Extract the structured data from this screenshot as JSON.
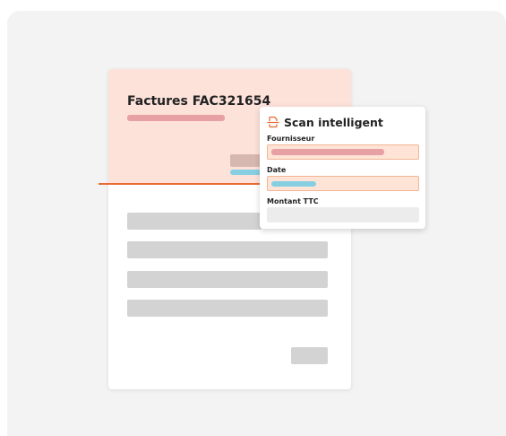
{
  "document": {
    "title": "Factures FAC321654"
  },
  "scan_panel": {
    "title": "Scan intelligent",
    "icon": "scan-document-icon",
    "fields": [
      {
        "label": "Fournisseur",
        "state": "extracted-redacted"
      },
      {
        "label": "Date",
        "state": "extracted-redacted"
      },
      {
        "label": "Montant TTC",
        "state": "empty"
      }
    ]
  },
  "colors": {
    "accent": "#e86b35",
    "highlight_bg": "#fde2da",
    "redacted_red": "#e7a0a3",
    "redacted_blue": "#86cfe3"
  }
}
